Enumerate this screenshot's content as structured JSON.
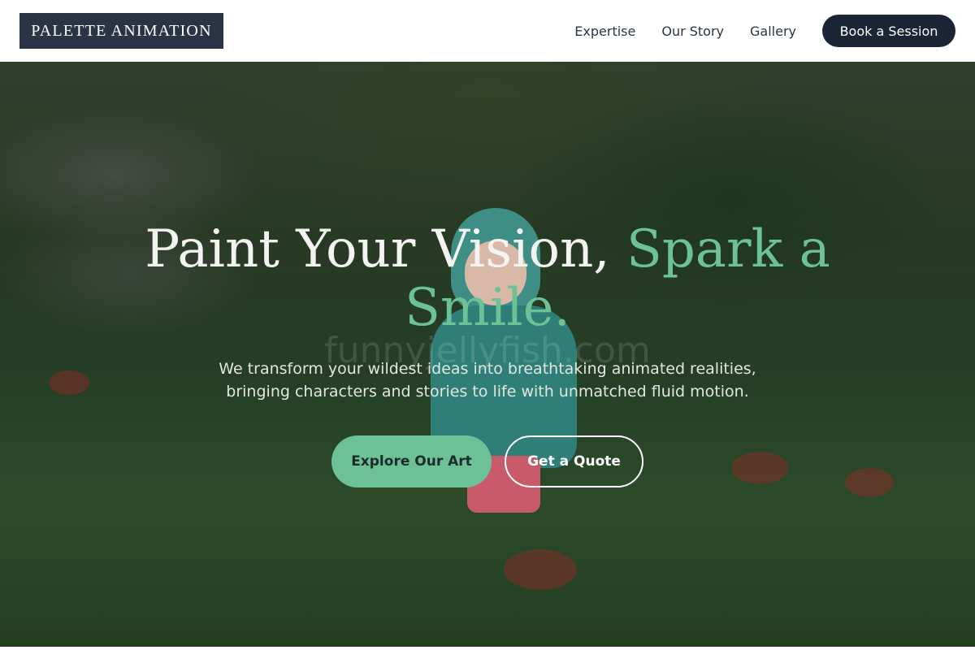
{
  "header": {
    "logo_text": "PALETTE ANIMATION",
    "nav": [
      {
        "label": "Expertise"
      },
      {
        "label": "Our Story"
      },
      {
        "label": "Gallery"
      }
    ],
    "cta_label": "Book a Session"
  },
  "hero": {
    "headline_plain": "Paint Your Vision, ",
    "headline_accent": "Spark a Smile.",
    "watermark": "funnyjellyfish.com",
    "subtitle": "We transform your wildest ideas into breathtaking animated realities, bringing characters and stories to life with unmatched fluid motion.",
    "primary_button": "Explore Our Art",
    "secondary_button": "Get a Quote"
  },
  "colors": {
    "brand_dark": "#2b3445",
    "button_dark": "#1c2536",
    "accent_green": "#6cc197"
  }
}
